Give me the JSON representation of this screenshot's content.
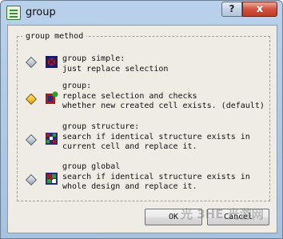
{
  "window": {
    "title": "group",
    "help_label": "?",
    "close_label": "x"
  },
  "group_box": {
    "label": "group method"
  },
  "options": [
    {
      "name": "group-simple",
      "checked": false,
      "text": "group simple:\njust replace selection"
    },
    {
      "name": "group",
      "checked": true,
      "text": "group:\nreplace selection and checks\nwhether new created cell exists. (default)"
    },
    {
      "name": "group-structure",
      "checked": false,
      "text": "group structure:\nsearch if identical structure exists in\ncurrent cell and replace it."
    },
    {
      "name": "group-global",
      "checked": false,
      "text": "group global\nsearch if identical structure exists in\nwhole design and replace it."
    }
  ],
  "buttons": {
    "ok": "OK",
    "cancel": "Cancel"
  },
  "watermark": {
    "text": "光 3HE 光游网"
  }
}
